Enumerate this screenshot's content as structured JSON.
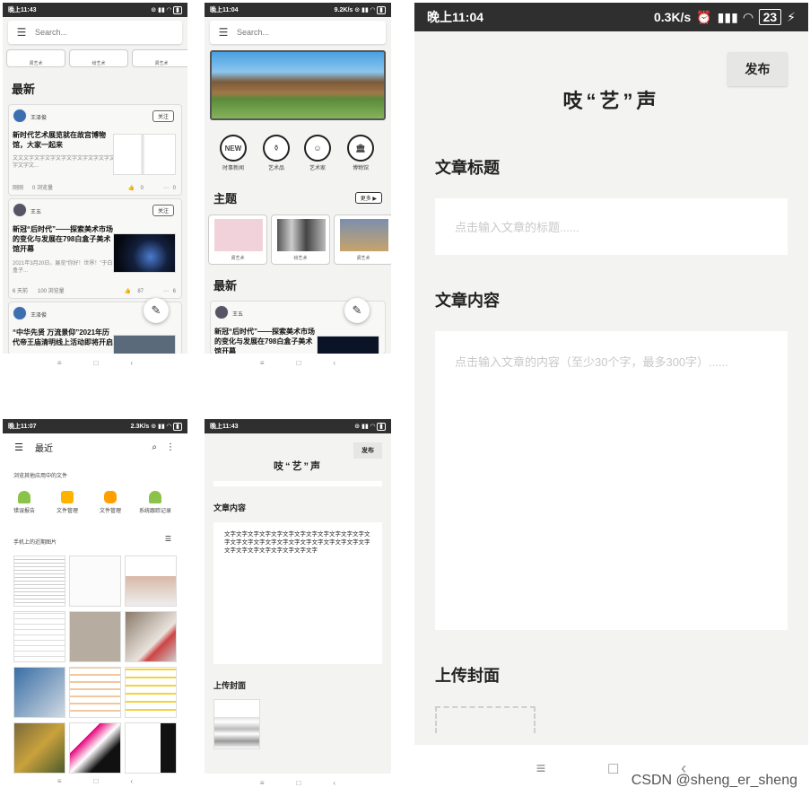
{
  "watermark": "CSDN @sheng_er_sheng",
  "colors": {
    "statusbar": "#2f2f2f",
    "background": "#f3f3f1",
    "accent_avatar": "#3d6fb0"
  },
  "phone1": {
    "status_time": "晚上11:43",
    "search_placeholder": "Search...",
    "categories": [
      "贤艺术",
      "纷艺术",
      "贤艺术"
    ],
    "section_latest": "最新",
    "cards": [
      {
        "author": "王泽俊",
        "follow": "关注",
        "title": "新时代艺术展览就在故宫博物馆，大家一起来",
        "summary": "文文文字文字文字文字文字文字文字文字文字文字文...",
        "time": "刚刚",
        "views": "0 浏览量",
        "likes": "0",
        "comments": "0"
      },
      {
        "author": "王五",
        "follow": "关注",
        "title": "新冠“后时代”——探索美术市场的变化与发展在798白盒子美术馆开幕",
        "summary": "2021年3月20日，展览“你好！世界！”于白盒子...",
        "time": "6 天前",
        "views": "100 浏览量",
        "likes": "87",
        "comments": "6"
      },
      {
        "author": "王泽俊",
        "follow": "",
        "title": "“中华先贤 万流景仰”2021年历代帝王庙清明线上活动即将开启",
        "summary": "",
        "time": "",
        "views": "",
        "likes": "",
        "comments": ""
      }
    ],
    "fab_icon": "feather-icon"
  },
  "phone2": {
    "status_time": "晚上11:04",
    "status_speed": "9.2K/s",
    "search_placeholder": "Search...",
    "icons": [
      {
        "label": "时事新闻",
        "glyph": "NEW"
      },
      {
        "label": "艺术品",
        "glyph": "⚱"
      },
      {
        "label": "艺术家",
        "glyph": "☺"
      },
      {
        "label": "博物馆",
        "glyph": "🏛"
      }
    ],
    "section_topic": "主题",
    "more": "更多 ▶",
    "topics": [
      "贤艺术",
      "纷艺术",
      "贤艺术"
    ],
    "section_latest": "最新",
    "card": {
      "author": "王五",
      "title": "新冠“后时代”——探索美术市场的变化与发展在798白盒子美术馆开幕"
    }
  },
  "phone3": {
    "status_time": "晚上11:07",
    "status_speed": "2.3K/s",
    "title": "最近",
    "browse_other": "浏览其他应用中的文件",
    "apps": [
      "错误报告",
      "文件管理",
      "文件管理",
      "系统跟踪记录"
    ],
    "recent_images": "手机上的近期图片"
  },
  "phone4": {
    "status_time": "晚上11:43",
    "publish": "发布",
    "title": "吱“艺”声",
    "content_label": "文章内容",
    "content_text": "文字文字文字文字文字文字文字文字文字文字文字文字文字文字文字文字文字文字文字文字文字文字文字文字文字文字文字文字文字文字文字文字文字",
    "cover_label": "上传封面"
  },
  "phone5": {
    "status_time": "晚上11:04",
    "status_speed": "0.3K/s",
    "status_battery": "23",
    "publish": "发布",
    "title": "吱“艺”声",
    "title_label": "文章标题",
    "title_placeholder": "点击输入文章的标题......",
    "content_label": "文章内容",
    "content_placeholder": "点击输入文章的内容（至少30个字，最多300字）......",
    "cover_label": "上传封面"
  }
}
